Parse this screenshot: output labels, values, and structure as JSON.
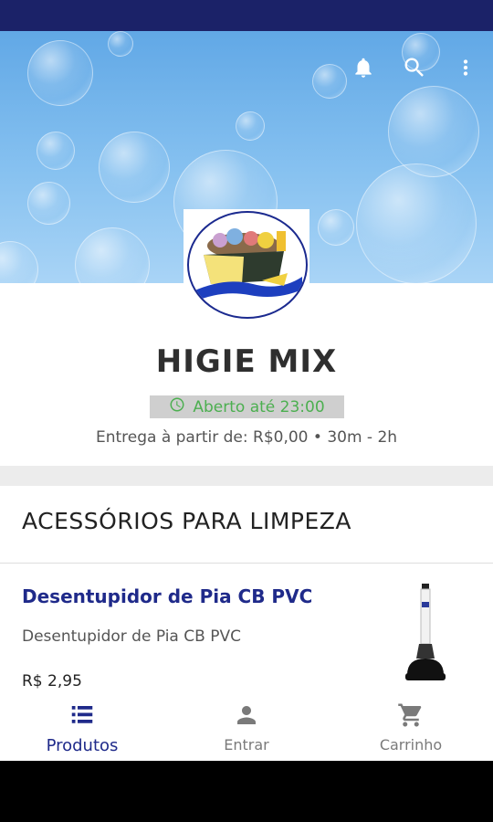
{
  "colors": {
    "primary": "#1f2a8a",
    "status_bar": "#1b2268",
    "open_green": "#4caf50"
  },
  "header": {
    "icons": [
      "bell-icon",
      "search-icon",
      "more-vert-icon"
    ]
  },
  "store": {
    "name": "HIGIE MIX",
    "status": "Aberto até 23:00",
    "delivery": "Entrega à partir de: R$0,00 • 30m - 2h"
  },
  "category": {
    "title": "ACESSÓRIOS PARA LIMPEZA"
  },
  "products": [
    {
      "name": "Desentupidor de Pia CB PVC",
      "description": "Desentupidor de Pia CB PVC",
      "price": "R$ 2,95"
    }
  ],
  "bottom_nav": {
    "items": [
      {
        "label": "Produtos",
        "icon": "list-icon",
        "active": true
      },
      {
        "label": "Entrar",
        "icon": "person-icon",
        "active": false
      },
      {
        "label": "Carrinho",
        "icon": "cart-icon",
        "active": false
      }
    ]
  }
}
